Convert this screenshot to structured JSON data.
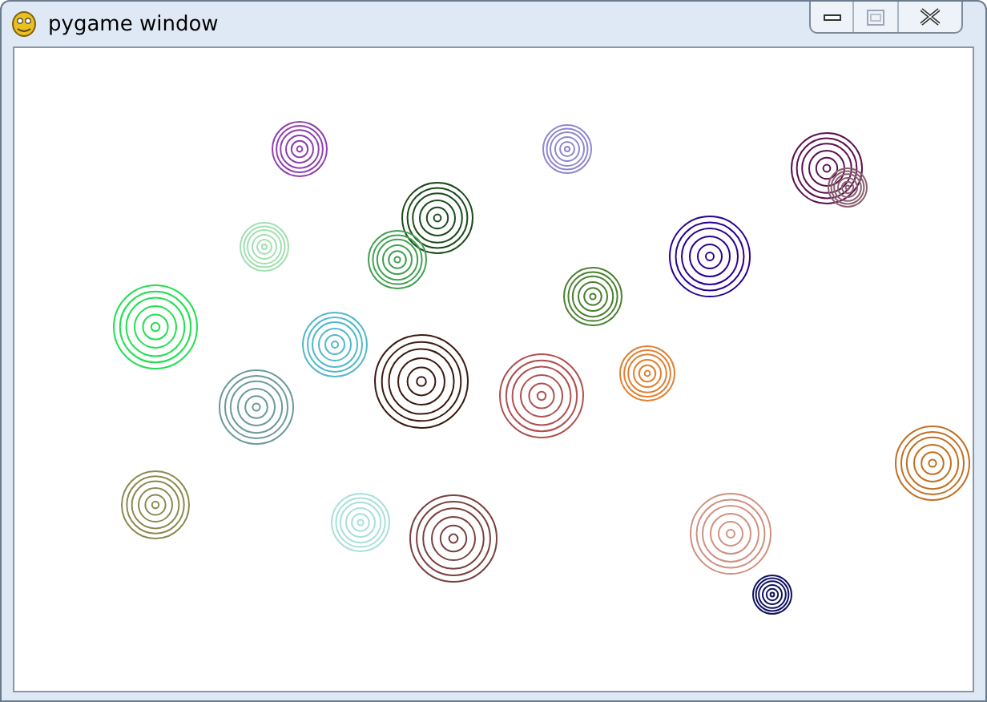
{
  "window": {
    "title": "pygame window"
  },
  "ripples": [
    {
      "color": "#8e3fb0"
    },
    {
      "color": "#8f86d0"
    },
    {
      "color": "#5c1050"
    },
    {
      "color": "#8a6070"
    },
    {
      "color": "#1a4a1a"
    },
    {
      "color": "#a0e0b0"
    },
    {
      "color": "#40a050"
    },
    {
      "color": "#2a0090"
    },
    {
      "color": "#4a8030"
    },
    {
      "color": "#20e050"
    },
    {
      "color": "#50b8c8"
    },
    {
      "color": "#3a1a10"
    },
    {
      "color": "#b05050"
    },
    {
      "color": "#e08030"
    },
    {
      "color": "#6a9a98"
    },
    {
      "color": "#c07020"
    },
    {
      "color": "#8a8a50"
    },
    {
      "color": "#a8e0d8"
    },
    {
      "color": "#7a4040"
    },
    {
      "color": "#d09080"
    },
    {
      "color": "#101060"
    }
  ]
}
